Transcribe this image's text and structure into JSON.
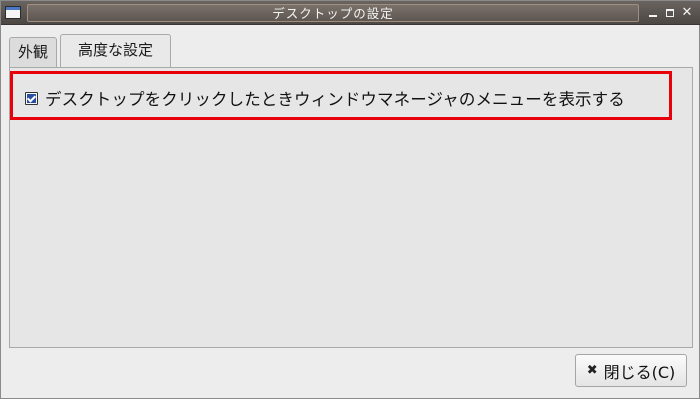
{
  "window": {
    "title": "デスクトップの設定"
  },
  "titlebar_buttons": {
    "minimize_icon": "minimize-icon",
    "maximize_icon": "maximize-icon",
    "close_symbol": "✕"
  },
  "tabs": [
    {
      "label": "外観",
      "selected": false
    },
    {
      "label": "高度な設定",
      "selected": true
    }
  ],
  "advanced": {
    "show_wm_menu_checkbox": {
      "label": "デスクトップをクリックしたときウィンドウマネージャのメニューを表示する",
      "checked": true
    }
  },
  "footer": {
    "close_button_label": "閉じる(C)",
    "close_button_icon": "✖"
  },
  "colors": {
    "highlight": "#e8000b",
    "titlebar": "#5a5450"
  }
}
